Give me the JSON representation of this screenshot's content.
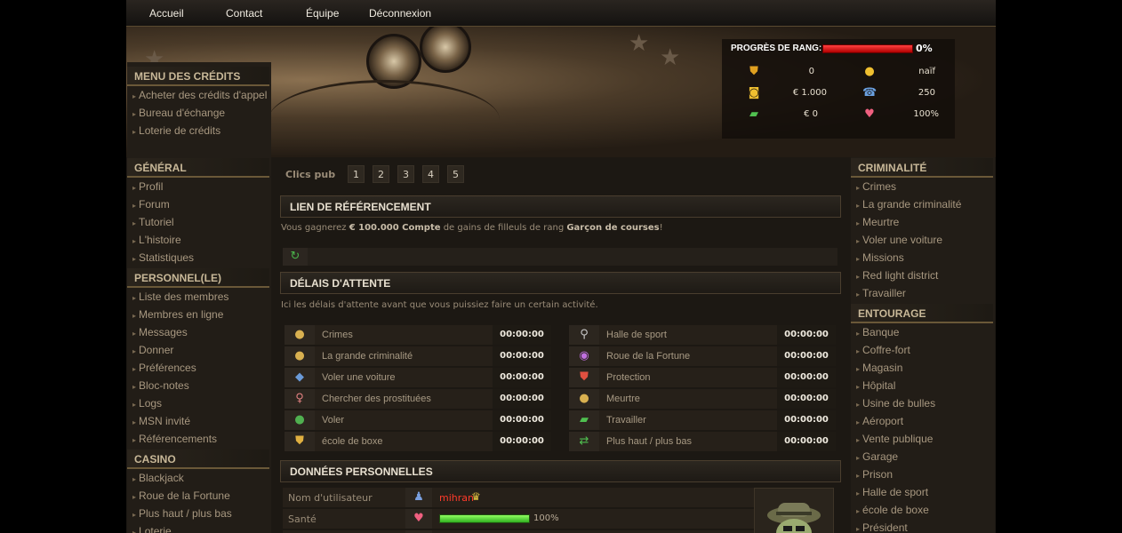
{
  "nav": {
    "items": [
      "Accueil",
      "Contact",
      "Équipe",
      "Déconnexion"
    ]
  },
  "rank": {
    "label": "PROGRÈS DE RANG:",
    "percent_text": "0%",
    "progress": 0,
    "stats": [
      {
        "icon": "shield-icon",
        "value": "0"
      },
      {
        "icon": "medal-icon",
        "value": "naïf"
      },
      {
        "icon": "coins-icon",
        "value": "€ 1.000"
      },
      {
        "icon": "phone-icon",
        "value": "250"
      },
      {
        "icon": "cash-icon",
        "value": "€ 0"
      },
      {
        "icon": "heart-icon",
        "value": "100%"
      }
    ]
  },
  "left_menu": {
    "credits": {
      "title": "MENU DES CRÉDITS",
      "items": [
        "Acheter des crédits d'appel",
        "Bureau d'échange",
        "Loterie de crédits"
      ]
    },
    "general": {
      "title": "GÉNÉRAL",
      "items": [
        "Profil",
        "Forum",
        "Tutoriel",
        "L'histoire",
        "Statistiques"
      ]
    },
    "personnel": {
      "title": "PERSONNEL(LE)",
      "items": [
        "Liste des membres",
        "Membres en ligne",
        "Messages",
        "Donner",
        "Préférences",
        "Bloc-notes",
        "Logs",
        "MSN invité",
        "Référencements"
      ]
    },
    "casino": {
      "title": "CASINO",
      "items": [
        "Blackjack",
        "Roue de la Fortune",
        "Plus haut / plus bas",
        "Loterie"
      ]
    }
  },
  "right_menu": {
    "criminalite": {
      "title": "CRIMINALITÉ",
      "items": [
        "Crimes",
        "La grande criminalité",
        "Meurtre",
        "Voler une voiture",
        "Missions",
        "Red light district",
        "Travailler"
      ]
    },
    "entourage": {
      "title": "ENTOURAGE",
      "items": [
        "Banque",
        "Coffre-fort",
        "Magasin",
        "Hôpital",
        "Usine de bulles",
        "Aéroport",
        "Vente publique",
        "Garage",
        "Prison",
        "Halle de sport",
        "école de boxe",
        "Président"
      ]
    }
  },
  "clics": {
    "label": "Clics pub",
    "pages": [
      "1",
      "2",
      "3",
      "4",
      "5"
    ]
  },
  "referral": {
    "title": "LIEN DE RÉFÉRENCEMENT",
    "text_pre": "Vous gagnerez ",
    "amount": "€ 100.000 Compte",
    "text_mid": " de gains de filleuls de rang ",
    "rank": "Garçon de courses",
    "text_post": "!"
  },
  "waits": {
    "title": "DÉLAIS D'ATTENTE",
    "desc": "Ici les délais d'attente avant que vous puissiez faire un certain activité.",
    "left": [
      {
        "icon": "bomb-icon",
        "label": "Crimes",
        "time": "00:00:00"
      },
      {
        "icon": "bomb-icon",
        "label": "La grande criminalité",
        "time": "00:00:00"
      },
      {
        "icon": "car-icon",
        "label": "Voler une voiture",
        "time": "00:00:00"
      },
      {
        "icon": "woman-icon",
        "label": "Chercher des prostituées",
        "time": "00:00:00"
      },
      {
        "icon": "money-bag-icon",
        "label": "Voler",
        "time": "00:00:00"
      },
      {
        "icon": "boxing-icon",
        "label": "école de boxe",
        "time": "00:00:00"
      }
    ],
    "right": [
      {
        "icon": "racket-icon",
        "label": "Halle de sport",
        "time": "00:00:00"
      },
      {
        "icon": "wheel-icon",
        "label": "Roue de la Fortune",
        "time": "00:00:00"
      },
      {
        "icon": "shield-icon",
        "label": "Protection",
        "time": "00:00:00"
      },
      {
        "icon": "bomb-icon",
        "label": "Meurtre",
        "time": "00:00:00"
      },
      {
        "icon": "cash-icon",
        "label": "Travailler",
        "time": "00:00:00"
      },
      {
        "icon": "arrows-icon",
        "label": "Plus haut / plus bas",
        "time": "00:00:00"
      }
    ]
  },
  "personal": {
    "title": "DONNÉES PERSONNELLES",
    "username_label": "Nom d'utilisateur",
    "username": "mihran",
    "health_label": "Santé",
    "health_text": "100%",
    "health": 1.0
  }
}
